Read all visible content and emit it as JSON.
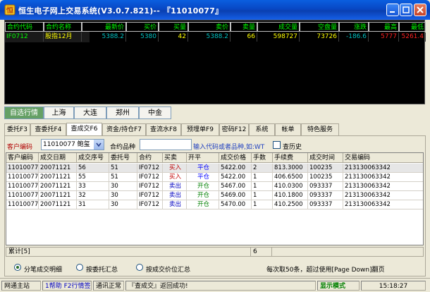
{
  "window": {
    "title": "恒生电子网上交易系统(V3.0.7.821)-- 『11010077』"
  },
  "quote": {
    "headers": [
      "合约代码",
      "合约名称",
      "最新价",
      "买价",
      "买量",
      "卖价",
      "卖量",
      "成交量",
      "空盘量",
      "涨跌",
      "最高",
      "最低"
    ],
    "row": {
      "code": "IF0712",
      "name": "股指12月",
      "last": "5388.2",
      "bid": "5380",
      "bid_vol": "42",
      "ask": "5388.2",
      "ask_vol": "66",
      "volume": "598727",
      "open_interest": "73726",
      "change": "-186.6",
      "high": "5777",
      "low": "5261.4"
    }
  },
  "market_tabs": [
    "自选行情",
    "上海",
    "大连",
    "郑州",
    "中金"
  ],
  "market_tab_active": 0,
  "trade_tabs": [
    "委托F3",
    "查委托F4",
    "查成交F6",
    "资金/持仓F7",
    "查流水F8",
    "预埋单F9",
    "密码F12",
    "系统",
    "帐单",
    "特色服务"
  ],
  "trade_tab_active": 2,
  "filter": {
    "account_label": "客户编码",
    "account_value": "11010077 鲍玺",
    "code_label": "合约品种",
    "code_value": "",
    "hint": "输入代码或者品种,如:WT",
    "history_label": "查历史"
  },
  "table": {
    "headers": [
      "客户编码",
      "成交日期",
      "成交序号",
      "委托号",
      "合约",
      "买卖",
      "开平",
      "成交价格",
      "手数",
      "手续费",
      "成交时间",
      "交易编码"
    ],
    "rows": [
      [
        "11010077",
        "20071121",
        "56",
        "51",
        "IF0712",
        "买入",
        "平仓",
        "5422.00",
        "2",
        "813.3000",
        "100235",
        "213130063342"
      ],
      [
        "11010077",
        "20071121",
        "55",
        "51",
        "IF0712",
        "买入",
        "平仓",
        "5422.00",
        "1",
        "406.6500",
        "100235",
        "213130063342"
      ],
      [
        "11010077",
        "20071121",
        "33",
        "30",
        "IF0712",
        "卖出",
        "开仓",
        "5467.00",
        "1",
        "410.0300",
        "093337",
        "213130063342"
      ],
      [
        "11010077",
        "20071121",
        "32",
        "30",
        "IF0712",
        "卖出",
        "开仓",
        "5469.00",
        "1",
        "410.1800",
        "093337",
        "213130063342"
      ],
      [
        "11010077",
        "20071121",
        "31",
        "30",
        "IF0712",
        "卖出",
        "开仓",
        "5470.00",
        "1",
        "410.2500",
        "093337",
        "213130063342"
      ]
    ],
    "summary_label": "累计[5]",
    "summary_qty": "6"
  },
  "options": {
    "radios": [
      "分笔成交明细",
      "按委托汇总",
      "按成交价位汇总"
    ],
    "selected": 0,
    "paging_note": "每次取50条，超过使用[Page Down]翻页"
  },
  "statusbar": {
    "server": "网通主站",
    "help": "1帮助 F2行情签",
    "conn": "通讯正常",
    "message": "『查成交』返回成功!",
    "mode": "显示模式",
    "time": "15:18:27"
  },
  "colors": {
    "header_green": "#00ff00",
    "price_up": "#ff2020",
    "price_down": "#00c0c0",
    "buy_red": "#c00000",
    "sell_blue": "#0000c0",
    "open_green": "#008000",
    "close_blue": "#0000ff"
  }
}
